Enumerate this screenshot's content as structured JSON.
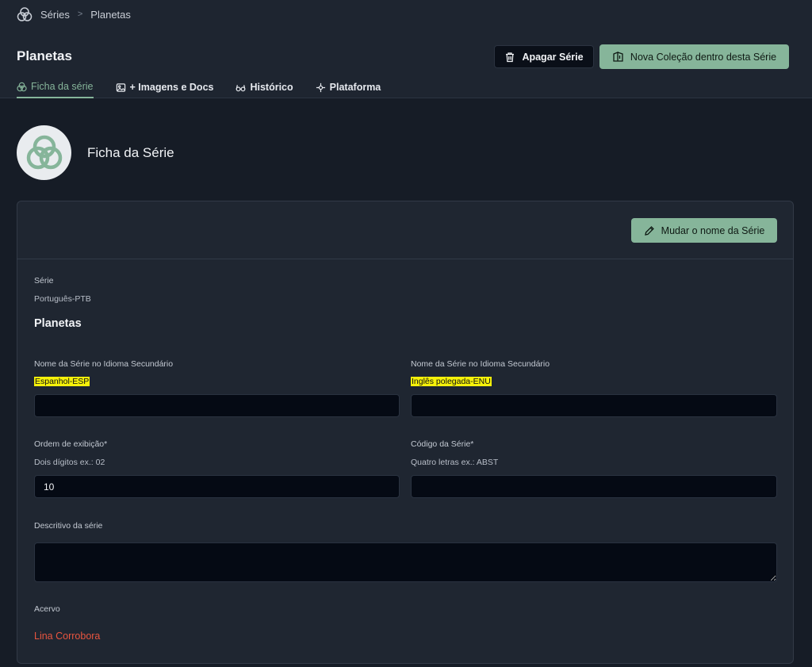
{
  "breadcrumb": {
    "root": "Séries",
    "current": "Planetas"
  },
  "header": {
    "title": "Planetas",
    "delete_label": "Apagar Série",
    "new_collection_label": "Nova Coleção dentro desta Série"
  },
  "tabs": [
    {
      "label": "Ficha da série",
      "icon": "circles-icon",
      "active": true
    },
    {
      "label": "+ Imagens e Docs",
      "icon": "image-icon",
      "active": false
    },
    {
      "label": "Histórico",
      "icon": "glasses-icon",
      "active": false
    },
    {
      "label": "Plataforma",
      "icon": "platform-icon",
      "active": false
    }
  ],
  "section": {
    "title": "Ficha da Série"
  },
  "card": {
    "rename_label": "Mudar o nome da Série",
    "serie_label": "Série",
    "primary_language": "Português-PTB",
    "serie_name": "Planetas",
    "secondary_left": {
      "label": "Nome da Série no Idioma Secundário",
      "language": "Espanhol-ESP",
      "value": ""
    },
    "secondary_right": {
      "label": "Nome da Série no Idioma Secundário",
      "language": "Inglês polegada-ENU",
      "value": ""
    },
    "order": {
      "label": "Ordem de exibição*",
      "hint": "Dois dígitos ex.: 02",
      "value": "10"
    },
    "code": {
      "label": "Código da Série*",
      "hint": "Quatro letras ex.: ABST",
      "value": ""
    },
    "description": {
      "label": "Descritivo da série",
      "value": ""
    },
    "collection": {
      "label": "Acervo",
      "owner": "Lina Corrobora"
    }
  },
  "colors": {
    "accent": "#86b59a",
    "background": "#161c26",
    "card": "#1f2631",
    "highlight": "#f5f10a",
    "owner": "#e8553f"
  }
}
